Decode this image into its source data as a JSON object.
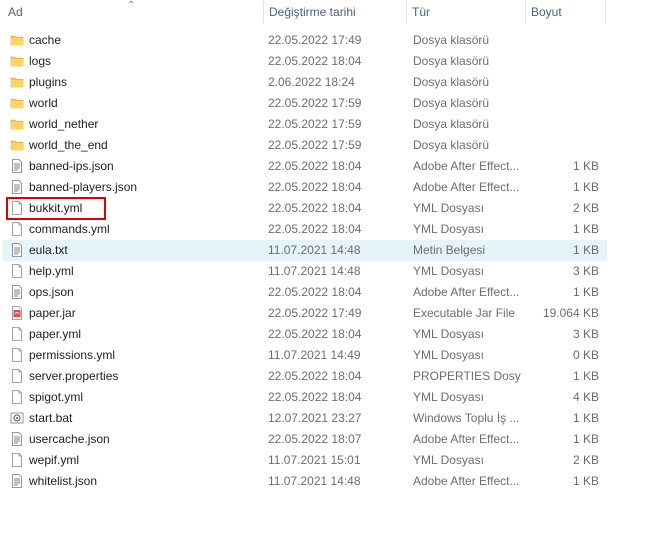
{
  "header": {
    "name": "Ad",
    "date": "Değiştirme tarihi",
    "type": "Tür",
    "size": "Boyut"
  },
  "files": [
    {
      "name": "cache",
      "date": "22.05.2022 17:49",
      "type": "Dosya klasörü",
      "size": "",
      "icon": "folder-icon"
    },
    {
      "name": "logs",
      "date": "22.05.2022 18:04",
      "type": "Dosya klasörü",
      "size": "",
      "icon": "folder-icon"
    },
    {
      "name": "plugins",
      "date": "2.06.2022 18:24",
      "type": "Dosya klasörü",
      "size": "",
      "icon": "folder-icon"
    },
    {
      "name": "world",
      "date": "22.05.2022 17:59",
      "type": "Dosya klasörü",
      "size": "",
      "icon": "folder-icon"
    },
    {
      "name": "world_nether",
      "date": "22.05.2022 17:59",
      "type": "Dosya klasörü",
      "size": "",
      "icon": "folder-icon"
    },
    {
      "name": "world_the_end",
      "date": "22.05.2022 17:59",
      "type": "Dosya klasörü",
      "size": "",
      "icon": "folder-icon"
    },
    {
      "name": "banned-ips.json",
      "date": "22.05.2022 18:04",
      "type": "Adobe After Effect...",
      "size": "1 KB",
      "icon": "text-file-icon"
    },
    {
      "name": "banned-players.json",
      "date": "22.05.2022 18:04",
      "type": "Adobe After Effect...",
      "size": "1 KB",
      "icon": "text-file-icon"
    },
    {
      "name": "bukkit.yml",
      "date": "22.05.2022 18:04",
      "type": "YML Dosyası",
      "size": "2 KB",
      "icon": "blank-file-icon"
    },
    {
      "name": "commands.yml",
      "date": "22.05.2022 18:04",
      "type": "YML Dosyası",
      "size": "1 KB",
      "icon": "blank-file-icon"
    },
    {
      "name": "eula.txt",
      "date": "11.07.2021 14:48",
      "type": "Metin Belgesi",
      "size": "1 KB",
      "icon": "text-file-icon"
    },
    {
      "name": "help.yml",
      "date": "11.07.2021 14:48",
      "type": "YML Dosyası",
      "size": "3 KB",
      "icon": "blank-file-icon"
    },
    {
      "name": "ops.json",
      "date": "22.05.2022 18:04",
      "type": "Adobe After Effect...",
      "size": "1 KB",
      "icon": "text-file-icon"
    },
    {
      "name": "paper.jar",
      "date": "22.05.2022 17:49",
      "type": "Executable Jar File",
      "size": "19.064 KB",
      "icon": "jar-file-icon"
    },
    {
      "name": "paper.yml",
      "date": "22.05.2022 18:04",
      "type": "YML Dosyası",
      "size": "3 KB",
      "icon": "blank-file-icon"
    },
    {
      "name": "permissions.yml",
      "date": "11.07.2021 14:49",
      "type": "YML Dosyası",
      "size": "0 KB",
      "icon": "blank-file-icon"
    },
    {
      "name": "server.properties",
      "date": "22.05.2022 18:04",
      "type": "PROPERTIES Dosyası",
      "size": "1 KB",
      "icon": "blank-file-icon"
    },
    {
      "name": "spigot.yml",
      "date": "22.05.2022 18:04",
      "type": "YML Dosyası",
      "size": "4 KB",
      "icon": "blank-file-icon"
    },
    {
      "name": "start.bat",
      "date": "12.07.2021 23:27",
      "type": "Windows Toplu İş ...",
      "size": "1 KB",
      "icon": "batch-file-icon"
    },
    {
      "name": "usercache.json",
      "date": "22.05.2022 18:07",
      "type": "Adobe After Effect...",
      "size": "1 KB",
      "icon": "text-file-icon"
    },
    {
      "name": "wepif.yml",
      "date": "11.07.2021 15:01",
      "type": "YML Dosyası",
      "size": "2 KB",
      "icon": "blank-file-icon"
    },
    {
      "name": "whitelist.json",
      "date": "11.07.2021 14:48",
      "type": "Adobe After Effect...",
      "size": "1 KB",
      "icon": "text-file-icon"
    }
  ],
  "selected_index": 10,
  "highlighted_index": 8,
  "colors": {
    "selection": "#e5f3fb",
    "highlight_box": "#e00000",
    "folder": "#f6c54a"
  }
}
